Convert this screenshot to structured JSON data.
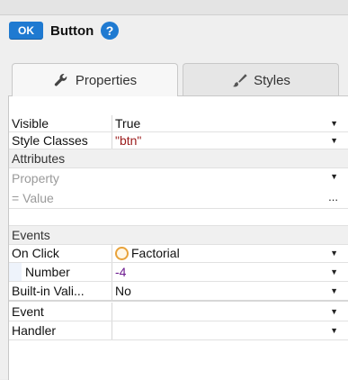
{
  "header": {
    "badge": "OK",
    "title": "Button"
  },
  "tabs": [
    {
      "label": "Properties",
      "icon": "wrench-icon",
      "active": true
    },
    {
      "label": "Styles",
      "icon": "brush-icon",
      "active": false
    }
  ],
  "properties": {
    "visible": {
      "label": "Visible",
      "value": "True"
    },
    "style_classes": {
      "label": "Style Classes",
      "value": "\"btn\""
    }
  },
  "attributes": {
    "section_label": "Attributes",
    "property_placeholder": "Property",
    "value_placeholder": "= Value",
    "ellipsis": "..."
  },
  "events": {
    "section_label": "Events",
    "on_click": {
      "label": "On Click",
      "value": "Factorial"
    },
    "number": {
      "label": "Number",
      "value": "-4"
    },
    "builtin": {
      "label": "Built-in Vali...",
      "value": "No"
    },
    "event": {
      "label": "Event",
      "value": ""
    },
    "handler": {
      "label": "Handler",
      "value": ""
    }
  },
  "colors": {
    "accent": "#1f7ad1",
    "string_value": "#9b1c1c",
    "number_value": "#6d1b8f",
    "factorial_ring": "#e8a23a"
  }
}
